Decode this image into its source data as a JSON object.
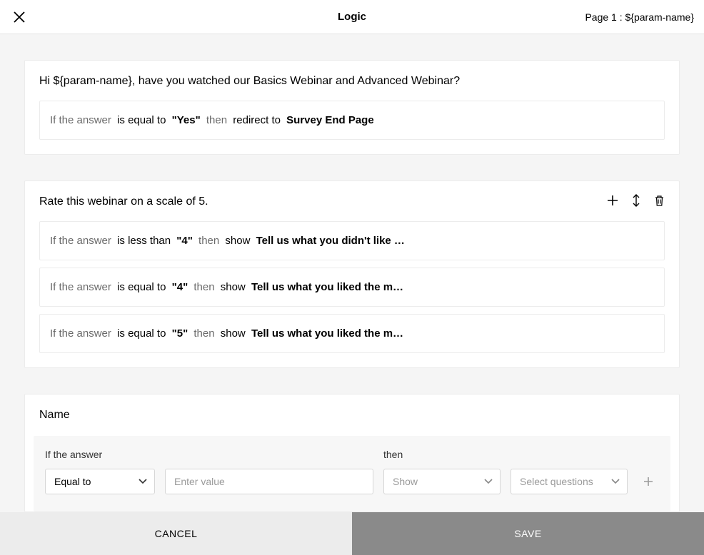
{
  "header": {
    "title": "Logic",
    "breadcrumb": "Page 1 : ${param-name}"
  },
  "cards": [
    {
      "question": "Hi ${param-name}, have you watched our Basics Webinar and Advanced Webinar?",
      "show_toolbar": false,
      "rules": [
        {
          "prefix": "If the answer",
          "op": "is equal to",
          "value": "\"Yes\"",
          "then": "then",
          "action": "redirect to",
          "target": "Survey End Page"
        }
      ]
    },
    {
      "question": "Rate this webinar on a scale of 5.",
      "show_toolbar": true,
      "rules": [
        {
          "prefix": "If the answer",
          "op": "is less than",
          "value": "\"4\"",
          "then": "then",
          "action": "show",
          "target": "Tell us what you didn't like …"
        },
        {
          "prefix": "If the answer",
          "op": "is equal to",
          "value": "\"4\"",
          "then": "then",
          "action": "show",
          "target": "Tell us what you liked the m…"
        },
        {
          "prefix": "If the answer",
          "op": "is equal to",
          "value": "\"5\"",
          "then": "then",
          "action": "show",
          "target": "Tell us what you liked the m…"
        }
      ]
    }
  ],
  "editor": {
    "section_title": "Name",
    "condition_label": "If the answer",
    "then_label": "then",
    "operator": "Equal to",
    "value_placeholder": "Enter value",
    "action": "Show",
    "target_placeholder": "Select questions"
  },
  "footer": {
    "cancel": "CANCEL",
    "save": "SAVE"
  }
}
